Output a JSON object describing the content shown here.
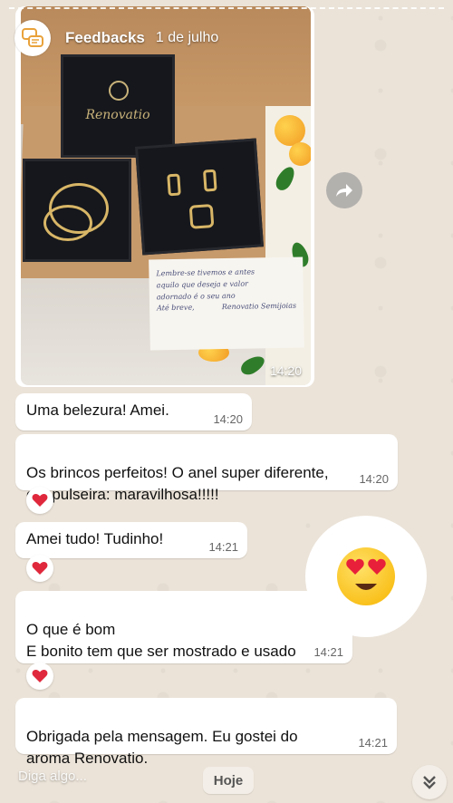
{
  "story": {
    "name": "Feedbacks",
    "date": "1 de julho"
  },
  "photo": {
    "time": "14:20",
    "note_lines": [
      "Lembre-se tivemos e antes",
      "aquilo que deseja e valor",
      "adornado é o seu ano",
      "Até breve,",
      "Renovatio Semijoias"
    ],
    "box_brand": "Renovatio"
  },
  "messages": [
    {
      "text": "Uma belezura! Amei.",
      "time": "14:20",
      "heart": false
    },
    {
      "text": "Os brincos perfeitos! O anel super diferente,\ne a pulseira: maravilhosa!!!!!",
      "time": "14:20",
      "heart": true
    },
    {
      "text": "Amei tudo! Tudinho!",
      "time": "14:21",
      "heart": true
    },
    {
      "text": "O que é bom\nE bonito tem que ser mostrado e usado",
      "time": "14:21",
      "heart": true
    },
    {
      "text": "Obrigada pela mensagem. Eu gostei do\naroma Renovatio.",
      "time": "14:21",
      "heart": false
    }
  ],
  "reply": {
    "placeholder": "Diga algo..."
  },
  "date_chip": "Hoje",
  "icons": {
    "avatar": "chat-bubbles-icon",
    "forward": "forward-icon",
    "heart": "heart-icon",
    "emoji": "heart-eyes-emoji",
    "scroll": "double-chevron-down-icon"
  },
  "colors": {
    "heart": "#e0283c",
    "bubble": "#ffffff",
    "background": "#ebe3d8"
  }
}
